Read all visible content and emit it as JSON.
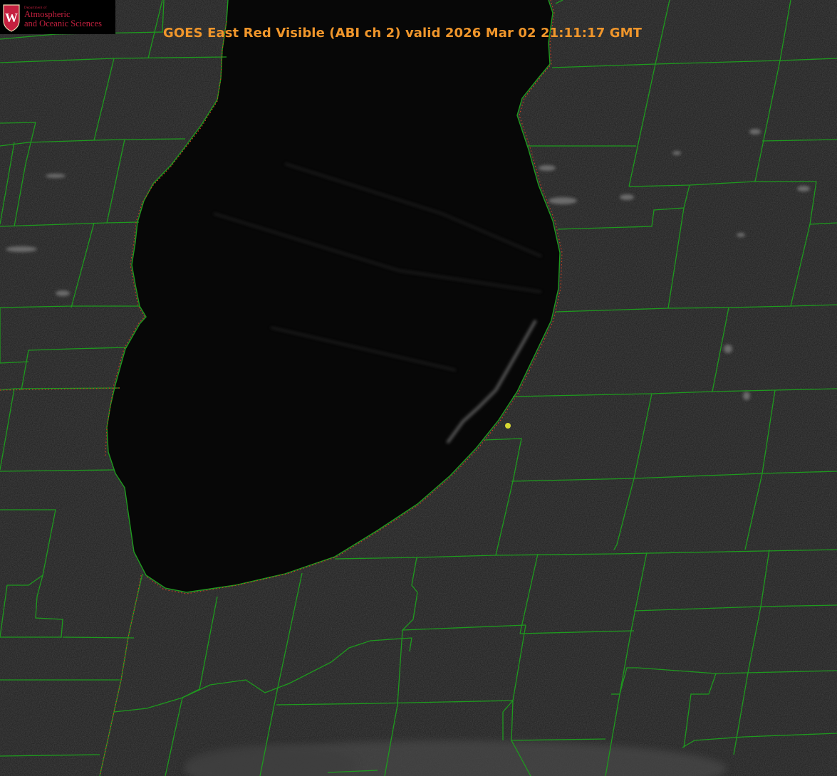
{
  "map": {
    "title": "GOES East Red Visible (ABI ch 2) valid 2026 Mar 02 21:11:17 GMT",
    "logo": {
      "department": "Department of",
      "name_line1": "Atmospheric",
      "name_line2": "and Oceanic Sciences",
      "crest_letter": "W"
    },
    "colors": {
      "land": "#1e1e1e",
      "lake": "#070707",
      "county_lines": "#1e9a1e",
      "state_line": "#c84020",
      "title": "#f0962b",
      "marker": "#d8d832",
      "logo_red": "#c5203f"
    },
    "marker_icon": "location-dot-icon"
  }
}
